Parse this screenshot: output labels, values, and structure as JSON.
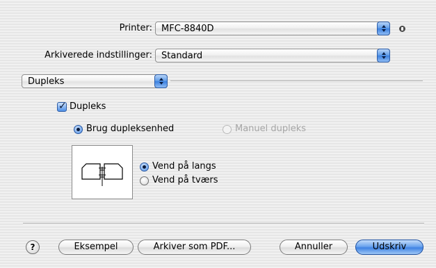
{
  "printer": {
    "label": "Printer:",
    "value": "MFC-8840D"
  },
  "presets": {
    "label": "Arkiverede indstillinger:",
    "value": "Standard"
  },
  "panel_menu": {
    "value": "Dupleks"
  },
  "duplex_checkbox": {
    "label": "Dupleks",
    "checked": true
  },
  "duplex_mode": {
    "options": [
      {
        "label": "Brug dupleksenhed",
        "selected": true,
        "enabled": true
      },
      {
        "label": "Manuel dupleks",
        "selected": false,
        "enabled": false
      }
    ]
  },
  "binding": {
    "options": [
      {
        "label": "Vend på langs",
        "selected": true
      },
      {
        "label": "Vend på tværs",
        "selected": false
      }
    ]
  },
  "buttons": {
    "help": "?",
    "preview": "Eksempel",
    "save_pdf": "Arkiver som PDF...",
    "cancel": "Annuller",
    "print": "Udskriv"
  },
  "colors": {
    "accent": "#4d8ee6",
    "background": "#ececec"
  },
  "icons": [
    "chevron-updown-icon",
    "info-icon",
    "checkmark-icon",
    "duplex-long-edge-icon",
    "help-icon"
  ]
}
